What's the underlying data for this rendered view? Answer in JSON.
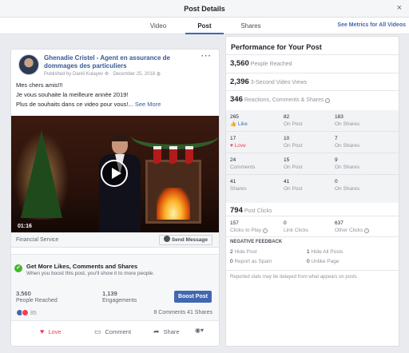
{
  "window": {
    "title": "Post Details",
    "close_glyph": "×"
  },
  "tabs": [
    {
      "label": "Video"
    },
    {
      "label": "Post",
      "active": true
    },
    {
      "label": "Shares"
    }
  ],
  "see_metrics_link": "See Metrics for All Videos",
  "post": {
    "author": "Ghenadie Cristel - Agent en assurance de dommages des particuliers",
    "published_by": "Published by Daniil Kulayev",
    "date": "December 25, 2018",
    "text_line1": "Mes chers amis!!!",
    "text_line2": "Je vous souhaite la meilleure année 2019!",
    "text_line3": "Plus de souhaits dans ce video pour vous!...",
    "see_more": "See More",
    "video_duration": "01:16",
    "category": "Financial Service",
    "send_message": "Send Message",
    "boost": {
      "title": "Get More Likes, Comments and Shares",
      "subtitle": "When you boost this post, you'll show it to more people.",
      "people_reached_value": "3,560",
      "people_reached_label": "People Reached",
      "engagements_value": "1,139",
      "engagements_label": "Engagements",
      "button": "Boost Post"
    },
    "reaction_count": "85",
    "comments": "8 Comments",
    "shares": "41 Shares",
    "actions": {
      "love": "Love",
      "comment": "Comment",
      "share": "Share"
    }
  },
  "performance": {
    "title": "Performance for Your Post",
    "people_reached": {
      "value": "3,560",
      "label": "People Reached"
    },
    "video_views": {
      "value": "2,396",
      "label": "3-Second Video Views"
    },
    "reactions_total": {
      "value": "346",
      "label": "Reactions, Comments & Shares"
    },
    "grid": [
      [
        {
          "value": "265",
          "label": "Like"
        },
        {
          "value": "82",
          "label": "On Post"
        },
        {
          "value": "183",
          "label": "On Shares"
        }
      ],
      [
        {
          "value": "17",
          "label": "Love"
        },
        {
          "value": "10",
          "label": "On Post"
        },
        {
          "value": "7",
          "label": "On Shares"
        }
      ],
      [
        {
          "value": "24",
          "label": "Comments"
        },
        {
          "value": "15",
          "label": "On Post"
        },
        {
          "value": "9",
          "label": "On Shares"
        }
      ],
      [
        {
          "value": "41",
          "label": "Shares"
        },
        {
          "value": "41",
          "label": "On Post"
        },
        {
          "value": "0",
          "label": "On Shares"
        }
      ]
    ],
    "post_clicks": {
      "value": "794",
      "label": "Post Clicks"
    },
    "clicks": [
      {
        "value": "157",
        "label": "Clicks to Play"
      },
      {
        "value": "0",
        "label": "Link Clicks"
      },
      {
        "value": "637",
        "label": "Other Clicks"
      }
    ],
    "negative_title": "NEGATIVE FEEDBACK",
    "negative": [
      {
        "value": "2",
        "label": "Hide Post"
      },
      {
        "value": "1",
        "label": "Hide All Posts"
      },
      {
        "value": "0",
        "label": "Report as Spam"
      },
      {
        "value": "0",
        "label": "Unlike Page"
      }
    ],
    "footnote": "Reported stats may be delayed from what appears on posts"
  },
  "colors": {
    "accent": "#4267b2",
    "love": "#f33e58",
    "success": "#42b72a"
  }
}
